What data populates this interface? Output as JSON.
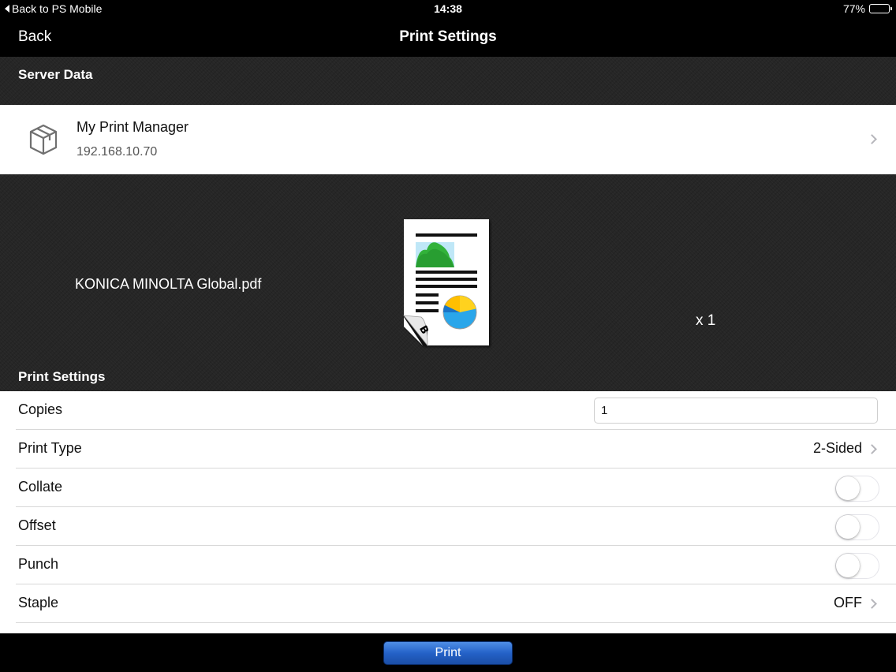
{
  "status_bar": {
    "back_app": "Back to PS Mobile",
    "time": "14:38",
    "battery": "77%",
    "battery_level": 0.77
  },
  "nav": {
    "back_label": "Back",
    "title": "Print Settings"
  },
  "server_section": {
    "header": "Server Data",
    "server_name": "My Print Manager",
    "server_ip": "192.168.10.70",
    "icon": "box-icon"
  },
  "document": {
    "file_name": "KONICA MINOLTA Global.pdf",
    "copy_indicator": "x 1",
    "page_badge": "B"
  },
  "settings_section": {
    "header": "Print Settings",
    "copies": {
      "label": "Copies",
      "value": "1"
    },
    "print_type": {
      "label": "Print Type",
      "value": "2-Sided"
    },
    "collate": {
      "label": "Collate",
      "on": false
    },
    "offset": {
      "label": "Offset",
      "on": false
    },
    "punch": {
      "label": "Punch",
      "on": false
    },
    "staple": {
      "label": "Staple",
      "value": "OFF"
    }
  },
  "bottom_bar": {
    "print_label": "Print"
  }
}
